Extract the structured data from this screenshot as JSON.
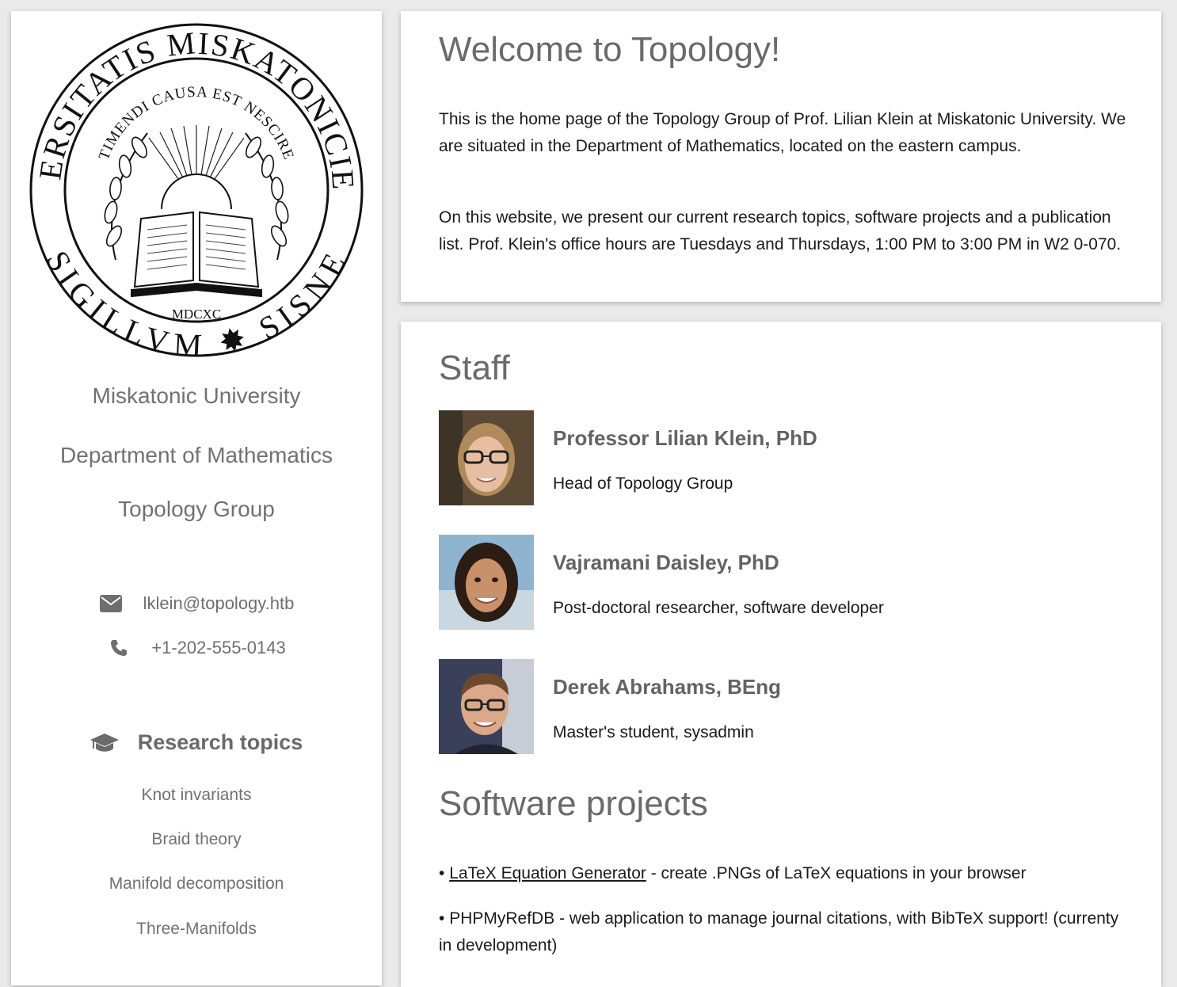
{
  "sidebar": {
    "seal": {
      "outer_text": "UNIVERSITATIS MISKATONICIENSIS",
      "outer_text_bottom": "SIGILLVM",
      "inner_text": "TIMENDI CAUSA EST NESCIRE",
      "year": "MDCXC"
    },
    "university": "Miskatonic University",
    "department": "Department of Mathematics",
    "group": "Topology Group",
    "email": "lklein@topology.htb",
    "phone": "+1-202-555-0143",
    "research_heading": "Research topics",
    "topics": [
      "Knot invariants",
      "Braid theory",
      "Manifold decomposition",
      "Three-Manifolds"
    ]
  },
  "welcome": {
    "title": "Welcome to Topology!",
    "para1": "This is the home page of the Topology Group of Prof. Lilian Klein at Miskatonic University. We are situated in the Department of Mathematics, located on the eastern campus.",
    "para2": "On this website, we present our current research topics, software projects and a publication list. Prof. Klein's office hours are Tuesdays and Thursdays, 1:00 PM to 3:00 PM in W2 0-070."
  },
  "staff": {
    "title": "Staff",
    "members": [
      {
        "name": "Professor Lilian Klein, PhD",
        "role": "Head of Topology Group"
      },
      {
        "name": "Vajramani Daisley, PhD",
        "role": "Post-doctoral researcher, software developer"
      },
      {
        "name": "Derek Abrahams, BEng",
        "role": "Master's student, sysadmin"
      }
    ]
  },
  "software": {
    "title": "Software projects",
    "bullet": "•",
    "projects": [
      {
        "link": "LaTeX Equation Generator",
        "text": " - create .PNGs of LaTeX equations in your browser"
      },
      {
        "name": "PHPMyRefDB",
        "text": " - web application to manage journal citations, with BibTeX support! (currenty in development)"
      }
    ]
  },
  "icons": {
    "email": "envelope-icon",
    "phone": "phone-icon",
    "research": "graduation-cap-icon"
  }
}
